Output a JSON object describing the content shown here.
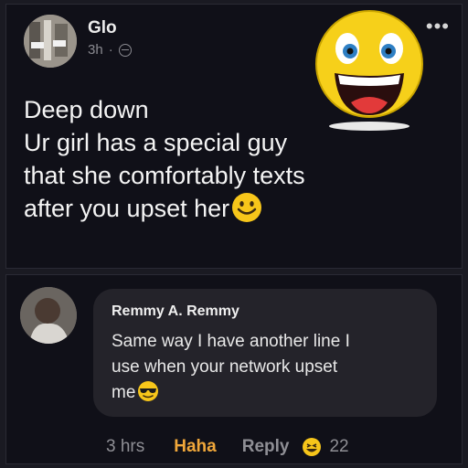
{
  "post": {
    "author": "Glo",
    "time": "3h",
    "separator": "·",
    "icons": [
      "globe-icon",
      "more-options-icon",
      "laughing-emoji-sticker",
      "smiling-emoji-icon"
    ],
    "lines": [
      "Deep down",
      "Ur girl has a special guy",
      "that she comfortably texts",
      "after you upset her"
    ]
  },
  "comment": {
    "author": "Remmy A. Remmy",
    "lines": [
      "Same way I have another line I",
      "use when your network upset",
      "me"
    ],
    "emoji": "sunglasses-emoji-icon",
    "time": "3 hrs",
    "reaction_label": "Haha",
    "reply_label": "Reply",
    "reaction_icon": "laughing-reaction-icon",
    "reaction_count": "22"
  },
  "colors": {
    "background": "#101018",
    "bubble": "#24232a",
    "emoji_yellow": "#f7d21b"
  }
}
